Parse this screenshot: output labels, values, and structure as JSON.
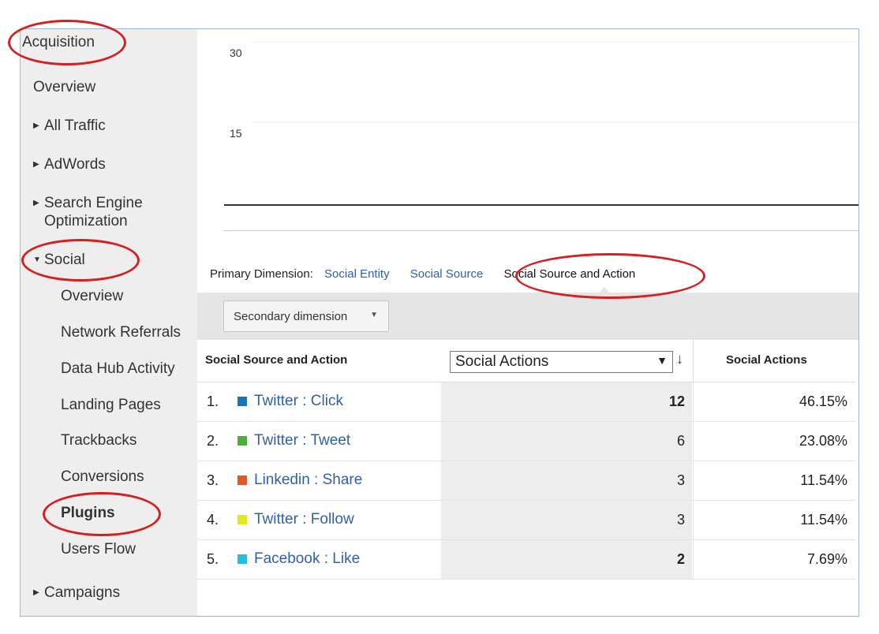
{
  "sidebar": {
    "section_title": "Acquisition",
    "overview": "Overview",
    "all_traffic": "All Traffic",
    "adwords": "AdWords",
    "seo_line1": "Search Engine",
    "seo_line2": "Optimization",
    "social": "Social",
    "social_items": [
      "Overview",
      "Network Referrals",
      "Data Hub Activity",
      "Landing Pages",
      "Trackbacks",
      "Conversions",
      "Plugins",
      "Users Flow"
    ],
    "campaigns": "Campaigns",
    "selected_item": "Plugins"
  },
  "chart": {
    "y_ticks": [
      "30",
      "15"
    ]
  },
  "dimensions": {
    "label": "Primary Dimension:",
    "options": [
      "Social Entity",
      "Social Source",
      "Social Source and Action"
    ],
    "selected": "Social Source and Action"
  },
  "secondary_dimension": {
    "label": "Secondary dimension"
  },
  "table": {
    "col_source": "Social Source and Action",
    "metric_select": "Social Actions",
    "col_percent": "Social Actions",
    "rows": [
      {
        "num": "1.",
        "name": "Twitter : Click",
        "color": "#1a74b8",
        "value": "12",
        "percent": "46.15%"
      },
      {
        "num": "2.",
        "name": "Twitter : Tweet",
        "color": "#4caf3a",
        "value": "6",
        "percent": "23.08%"
      },
      {
        "num": "3.",
        "name": "Linkedin : Share",
        "color": "#e05a26",
        "value": "3",
        "percent": "11.54%"
      },
      {
        "num": "4.",
        "name": "Twitter : Follow",
        "color": "#e3e81c",
        "value": "3",
        "percent": "11.54%"
      },
      {
        "num": "5.",
        "name": "Facebook : Like",
        "color": "#27bde0",
        "value": "2",
        "percent": "7.69%"
      }
    ]
  },
  "colors": {
    "link": "#2f5fae",
    "annotation": "#d42020",
    "sidebar_bg": "#eeeeee"
  }
}
